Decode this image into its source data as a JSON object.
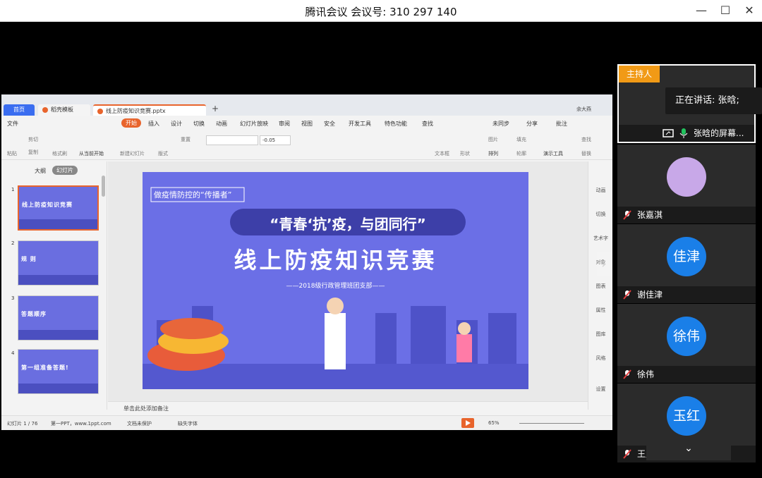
{
  "window": {
    "title": "腾讯会议 会议号: 310 297 140",
    "minimize": "—",
    "maximize": "☐",
    "close": "✕"
  },
  "wps": {
    "tabs": {
      "home": "首页",
      "templates": "稻壳模板",
      "doc": "线上防疫知识竞赛.pptx",
      "new": "+"
    },
    "user_name": "余大燕",
    "menu": [
      "文件",
      "开始",
      "插入",
      "设计",
      "切换",
      "动画",
      "幻灯片放映",
      "审阅",
      "视图",
      "安全",
      "开发工具",
      "特色功能",
      "查找"
    ],
    "menu_right": [
      "未同步",
      "分享",
      "批注"
    ],
    "ribbon": {
      "paste": "粘贴",
      "cut": "剪切",
      "copy": "复制",
      "format_painter": "格式刷",
      "from_current": "从当前开始",
      "new_slide": "新建幻灯片",
      "layout": "版式",
      "reset": "重置",
      "font_size": "-0.05",
      "textbox": "文本框",
      "shape": "形状",
      "arrange": "排列",
      "picture": "图片",
      "fill": "填充",
      "outline": "轮廓",
      "presentation_tools": "演示工具",
      "find": "查找",
      "replace": "替换"
    },
    "sidebar": {
      "outline": "大纲",
      "slides": "幻灯片"
    },
    "thumbnails": [
      {
        "num": "1",
        "title": "线上防疫知识竞赛"
      },
      {
        "num": "2",
        "title": "规 则"
      },
      {
        "num": "3",
        "title": "答题顺序"
      },
      {
        "num": "4",
        "title": "第一组准备答题!"
      }
    ],
    "slide": {
      "tagline": "做疫情防控的“传播者”",
      "banner": "“青春‘抗’疫，与团同行”",
      "title": "线上防疫知识竞赛",
      "subtitle": "——2018级行政管理班团支部——"
    },
    "notes_placeholder": "单击此处添加备注",
    "right_panel": [
      "动画",
      "切换",
      "艺术字",
      "对象",
      "图表",
      "属性",
      "图库",
      "风格",
      "设置"
    ],
    "status": {
      "slide_counter": "幻灯片 1 / 76",
      "theme": "第一PPT，www.1ppt.com",
      "protection": "文档未保护",
      "missing_fonts": "缺失字体",
      "zoom": "65%"
    }
  },
  "speaking": "正在讲话: 张晗;",
  "participants": [
    {
      "name": "张晗的屏幕...",
      "role": "主持人",
      "avatar": "photo",
      "muted": false,
      "sharing": true
    },
    {
      "name": "张嘉淇",
      "avatar": "photo",
      "muted": true
    },
    {
      "name": "谢佳津",
      "avatar_text": "佳津",
      "muted": true
    },
    {
      "name": "徐伟",
      "avatar_text": "徐伟",
      "muted": true
    },
    {
      "name": "王玉红",
      "avatar_text": "玉红",
      "muted": true
    }
  ],
  "colors": {
    "accent_orange": "#e8642c",
    "host_badge": "#f19a16",
    "avatar_blue": "#1a7fe8",
    "slide_purple": "#6b6fe6",
    "mute_red": "#e03c3c",
    "mic_green": "#22c35e"
  }
}
